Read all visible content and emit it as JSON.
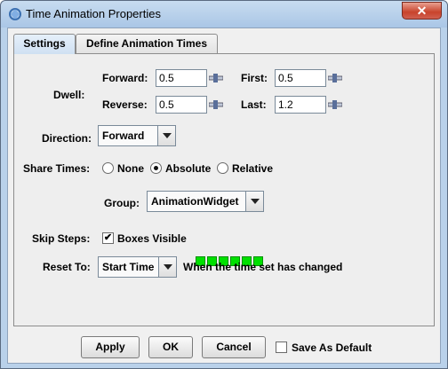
{
  "window": {
    "title": "Time Animation Properties",
    "close_label": "✕"
  },
  "tabs": [
    {
      "label": "Settings"
    },
    {
      "label": "Define Animation Times"
    }
  ],
  "dwell": {
    "label": "Dwell:",
    "forward_label": "Forward:",
    "forward_value": "0.5",
    "reverse_label": "Reverse:",
    "reverse_value": "0.5",
    "first_label": "First:",
    "first_value": "0.5",
    "last_label": "Last:",
    "last_value": "1.2"
  },
  "direction": {
    "label": "Direction:",
    "value": "Forward"
  },
  "share_times": {
    "label": "Share Times:",
    "options": [
      {
        "label": "None",
        "selected": false
      },
      {
        "label": "Absolute",
        "selected": true
      },
      {
        "label": "Relative",
        "selected": false
      }
    ]
  },
  "group": {
    "label": "Group:",
    "value": "AnimationWidget"
  },
  "skip_steps": {
    "label": "Skip Steps:",
    "checkbox_label": "Boxes Visible",
    "checked": true,
    "boxes_count": 6
  },
  "reset_to": {
    "label": "Reset To:",
    "value": "Start Time",
    "note": "When the time set has changed"
  },
  "buttons": {
    "apply": "Apply",
    "ok": "OK",
    "cancel": "Cancel",
    "save_default_label": "Save As Default"
  },
  "colors": {
    "titlebar": "#aac6e6",
    "close": "#c8432c",
    "boxes": "#00e000"
  }
}
